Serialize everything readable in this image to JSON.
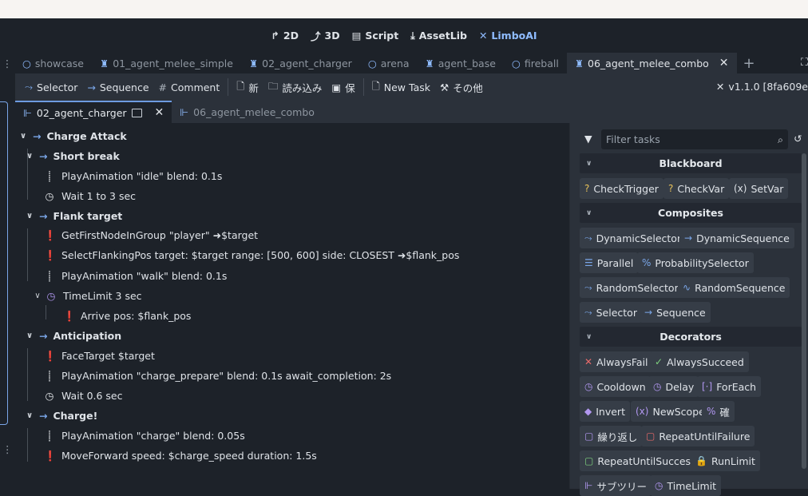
{
  "main_toolbar": {
    "buttons": [
      {
        "label": "2D",
        "icon": "2d-icon"
      },
      {
        "label": "3D",
        "icon": "3d-icon"
      },
      {
        "label": "Script",
        "icon": "script-icon"
      },
      {
        "label": "AssetLib",
        "icon": "assetlib-icon"
      },
      {
        "label": "LimboAI",
        "icon": "limboai-icon",
        "active": true
      }
    ]
  },
  "scene_tabs": [
    {
      "label": "showcase",
      "icon": "circle-icon"
    },
    {
      "label": "01_agent_melee_simple",
      "icon": "agent-icon"
    },
    {
      "label": "02_agent_charger",
      "icon": "agent-icon"
    },
    {
      "label": "arena",
      "icon": "circle-icon"
    },
    {
      "label": "agent_base",
      "icon": "agent-icon"
    },
    {
      "label": "fireball",
      "icon": "circle-icon"
    },
    {
      "label": "06_agent_melee_combo",
      "icon": "agent-icon",
      "active": true
    }
  ],
  "editor_toolbar": {
    "selector": "Selector",
    "sequence": "Sequence",
    "comment": "Comment",
    "new": "新",
    "load": "読み込み",
    "save": "保",
    "new_task": "New Task",
    "misc": "その他",
    "version": "v1.1.0 [8fa609e"
  },
  "subtabs": [
    {
      "label": "02_agent_charger",
      "active": true
    },
    {
      "label": "06_agent_melee_combo",
      "active": false
    }
  ],
  "tree": [
    {
      "text": "Charge Attack",
      "bold": true
    },
    {
      "text": "Short break",
      "bold": true
    },
    {
      "text": "PlayAnimation \"idle\"  blend: 0.1s"
    },
    {
      "text": "Wait 1 to 3 sec"
    },
    {
      "text": "Flank target",
      "bold": true
    },
    {
      "text": "GetFirstNodeInGroup \"player\"  ➜$target"
    },
    {
      "text": "SelectFlankingPos  target: $target  range: [500, 600]  side: CLOSEST  ➜$flank_pos"
    },
    {
      "text": "PlayAnimation \"walk\"  blend: 0.1s"
    },
    {
      "text": "TimeLimit 3 sec"
    },
    {
      "text": "Arrive  pos: $flank_pos"
    },
    {
      "text": "Anticipation",
      "bold": true
    },
    {
      "text": "FaceTarget $target"
    },
    {
      "text": "PlayAnimation \"charge_prepare\"  blend: 0.1s  await_completion: 2s"
    },
    {
      "text": "Wait 0.6 sec"
    },
    {
      "text": "Charge!",
      "bold": true
    },
    {
      "text": "PlayAnimation \"charge\"  blend: 0.05s"
    },
    {
      "text": "MoveForward  speed: $charge_speed  duration: 1.5s"
    }
  ],
  "task_panel": {
    "filter_placeholder": "Filter tasks",
    "sections": {
      "blackboard": "Blackboard",
      "composites": "Composites",
      "decorators": "Decorators"
    },
    "blackboard_tasks": [
      "CheckTrigger",
      "CheckVar",
      "SetVar"
    ],
    "composite_tasks": [
      "DynamicSelector",
      "DynamicSequence",
      "Parallel",
      "ProbabilitySelector",
      "RandomSelector",
      "RandomSequence",
      "Selector",
      "Sequence"
    ],
    "decorator_tasks": [
      "AlwaysFail",
      "AlwaysSucceed",
      "Cooldown",
      "Delay",
      "ForEach",
      "Invert",
      "NewScope",
      "確",
      "繰り返し",
      "RepeatUntilFailure",
      "RepeatUntilSuccess",
      "RunLimit",
      "サブツリー",
      "TimeLimit"
    ]
  }
}
